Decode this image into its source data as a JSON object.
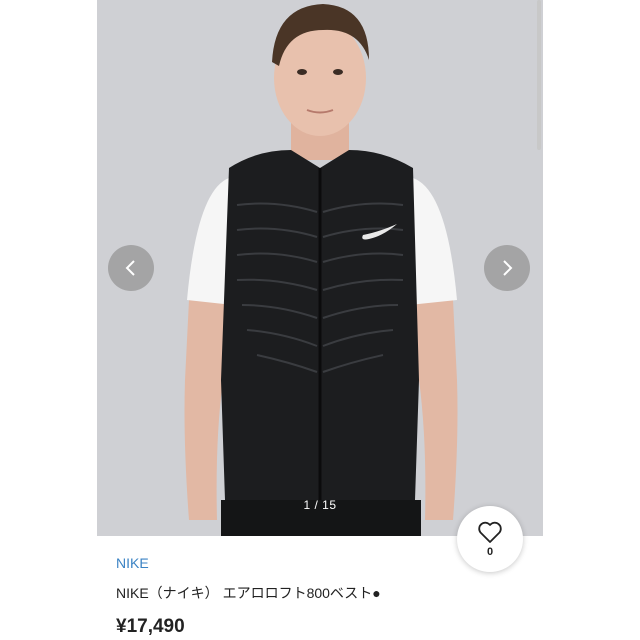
{
  "gallery": {
    "counter": "1 / 15",
    "prev_icon": "chevron-left-icon",
    "next_icon": "chevron-right-icon"
  },
  "like": {
    "icon": "heart-icon",
    "count": "0"
  },
  "product": {
    "brand": "NIKE",
    "title": "NIKE（ナイキ） エアロロフト800ベスト●",
    "price": "¥17,490"
  },
  "colors": {
    "brand_link": "#3b83c4",
    "photo_bg": "#cfd0d4",
    "vest": "#1c1d1f"
  }
}
